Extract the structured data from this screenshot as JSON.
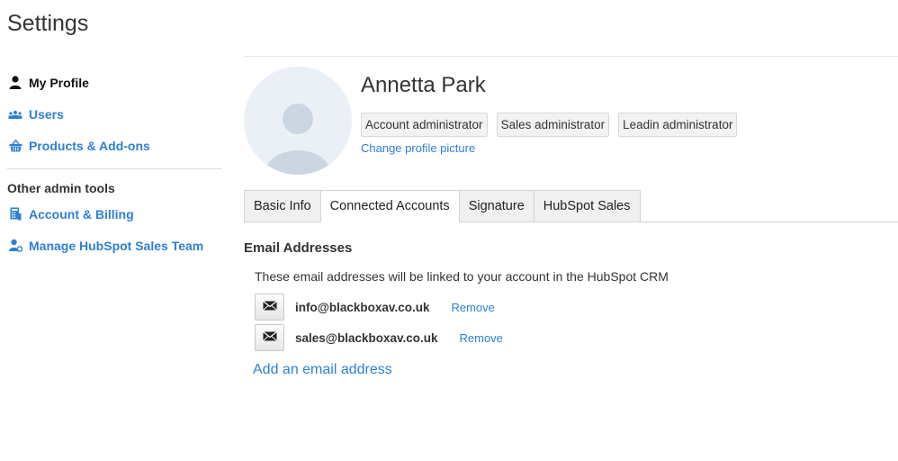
{
  "header": {
    "title": "Settings"
  },
  "sidebar": {
    "items": [
      {
        "label": "My Profile",
        "icon": "person-icon",
        "active": true
      },
      {
        "label": "Users",
        "icon": "users-icon"
      },
      {
        "label": "Products & Add-ons",
        "icon": "basket-icon"
      }
    ],
    "admin_heading": "Other admin tools",
    "admin_items": [
      {
        "label": "Account & Billing",
        "icon": "billing-icon"
      },
      {
        "label": "Manage HubSpot Sales Team",
        "icon": "team-icon"
      }
    ]
  },
  "profile": {
    "name": "Annetta Park",
    "roles": [
      "Account administrator",
      "Sales administrator",
      "Leadin administrator"
    ],
    "change_picture": "Change profile picture"
  },
  "tabs": [
    {
      "label": "Basic Info"
    },
    {
      "label": "Connected Accounts",
      "active": true
    },
    {
      "label": "Signature"
    },
    {
      "label": "HubSpot Sales"
    }
  ],
  "emails": {
    "title": "Email Addresses",
    "description": "These email addresses will be linked to your account in the HubSpot CRM",
    "items": [
      {
        "address": "info@blackboxav.co.uk",
        "remove": "Remove"
      },
      {
        "address": "sales@blackboxav.co.uk",
        "remove": "Remove"
      }
    ],
    "add_label": "Add an email address"
  },
  "colors": {
    "link": "#2e7fd4",
    "avatar_bg": "#eaf0f6",
    "avatar_fg": "#cbd6e2"
  }
}
